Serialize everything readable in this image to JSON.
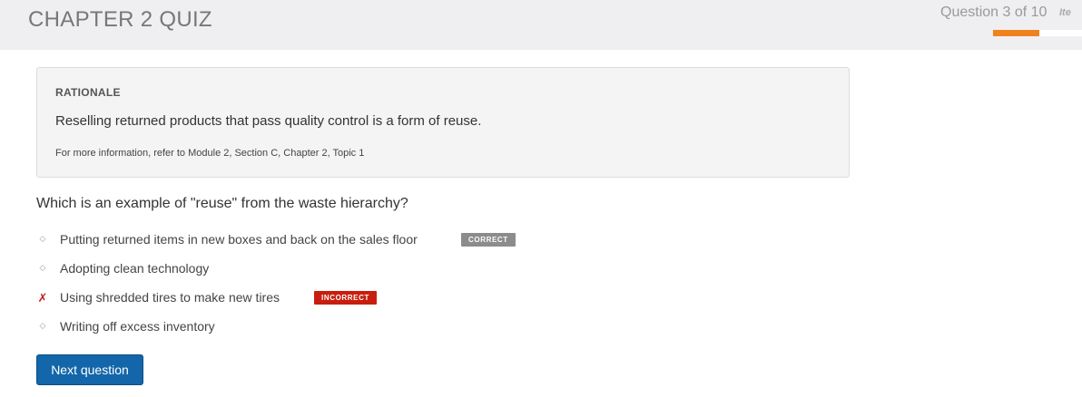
{
  "header": {
    "title": "CHAPTER 2 QUIZ",
    "progress_label": "Question 3 of 10",
    "items_link": "Ite",
    "progress_fraction": 0.3,
    "progress_color": "#f0821e"
  },
  "rationale": {
    "heading": "RATIONALE",
    "text": "Reselling returned products that pass quality control is a form of reuse.",
    "reference": "For more information, refer to Module 2, Section C, Chapter 2, Topic 1"
  },
  "question": {
    "text": "Which is an example of \"reuse\" from the waste hierarchy?",
    "answers": [
      {
        "text": "Putting returned items in new boxes and back on the sales floor",
        "marker": "diamond-icon",
        "badge": "CORRECT"
      },
      {
        "text": "Adopting clean technology",
        "marker": "diamond-icon",
        "badge": ""
      },
      {
        "text": "Using shredded tires to make new tires",
        "marker": "x-mark-icon",
        "badge": "INCORRECT"
      },
      {
        "text": "Writing off excess inventory",
        "marker": "diamond-icon",
        "badge": ""
      }
    ]
  },
  "actions": {
    "next_label": "Next question"
  },
  "colors": {
    "correct_badge": "#8c8c8c",
    "incorrect_badge": "#c81e0f",
    "primary_button": "#1266a9"
  }
}
